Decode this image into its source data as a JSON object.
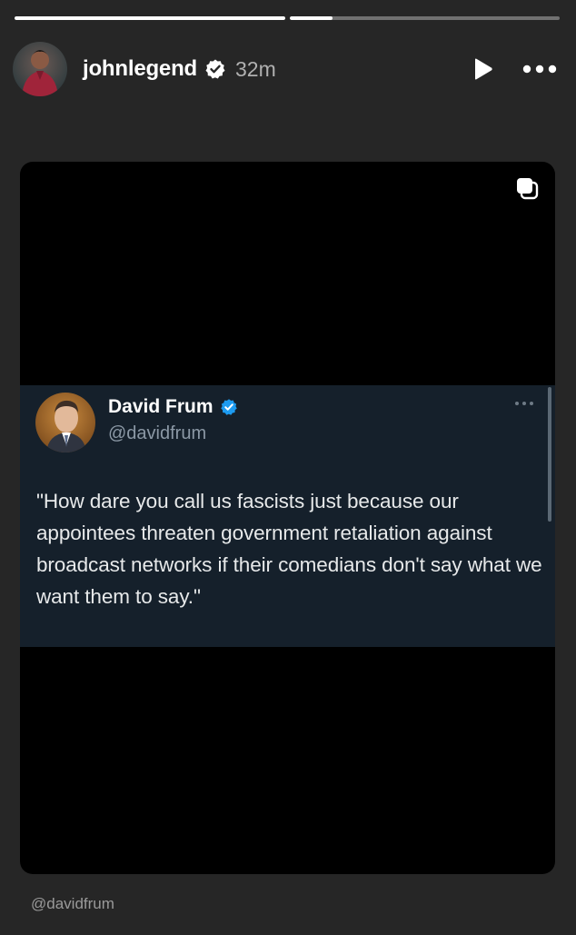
{
  "story": {
    "progress": [
      1.0,
      0.16
    ],
    "username": "johnlegend",
    "time": "32m",
    "icons": {
      "verified": "verified-badge-icon",
      "play": "play-icon",
      "more": "more-horizontal-icon",
      "multi": "multiple-items-icon"
    }
  },
  "tweet": {
    "name": "David Frum",
    "handle": "@davidfrum",
    "text": "\"How dare you call us fascists just because our appointees threaten government retaliation against broadcast networks if their comedians don't say what we want them to say.\"",
    "verified_color": "#1d9bf0"
  },
  "attribution": "@davidfrum"
}
